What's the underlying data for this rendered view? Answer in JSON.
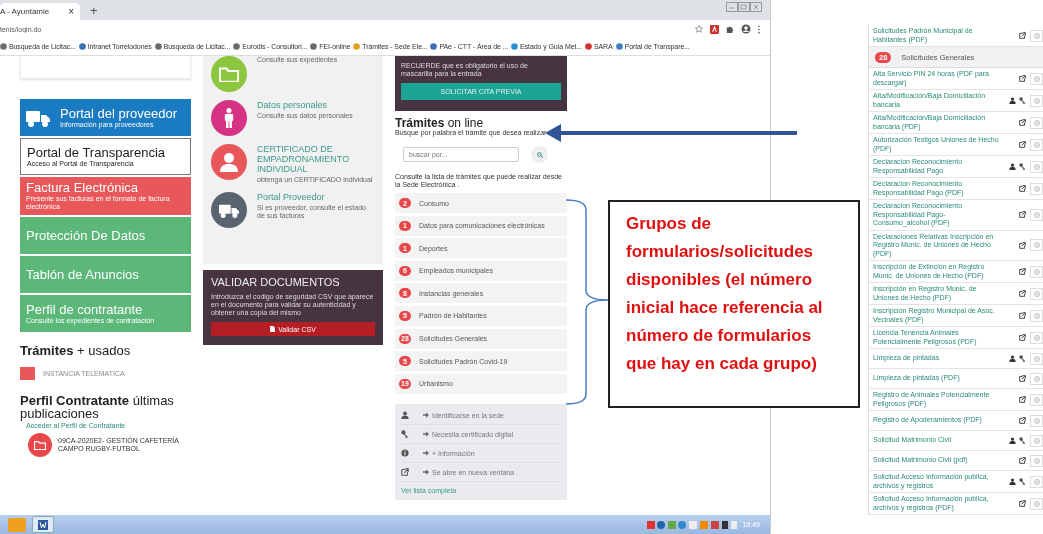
{
  "browser": {
    "tab": {
      "title": "A - Ayuntamie",
      "close": "×"
    },
    "new_tab": "+",
    "address": "tenis/login.do",
    "bookmarks": [
      {
        "label": "Busqueda de Licitac...",
        "color": "#6b6b6b"
      },
      {
        "label": "Intranet Torrelodones",
        "color": "#3b6fb6"
      },
      {
        "label": "Busqueda de Licitac...",
        "color": "#6b6b6b"
      },
      {
        "label": "Eurodis - Consultori...",
        "color": "#6b6b6b"
      },
      {
        "label": "FEI-online",
        "color": "#6b6b6b"
      },
      {
        "label": "Trámites - Sede Ele...",
        "color": "#e0a020"
      },
      {
        "label": "PAe - CTT - Área de ...",
        "color": "#3b6fb6"
      },
      {
        "label": "Estado y Guía Met...",
        "color": "#2a8fd0"
      },
      {
        "label": "SARA",
        "color": "#d83030"
      },
      {
        "label": "Portal de Transpare...",
        "color": "#3b7fc0"
      }
    ]
  },
  "page": {
    "tiles": [
      {
        "title": "**Portal** del proveedor",
        "subtitle": "Información para proveedores",
        "color": "#1a7ac2"
      },
      {
        "title": "Portal de Transparencia",
        "subtitle": "Acceso al Portal de Transparencia",
        "color": "#ffffff"
      },
      {
        "title": "**Factura** Electrónica",
        "subtitle": "Presente sus facturas en el formato de factura electrónica",
        "color": "#e8585a"
      },
      {
        "title": "Protección De Datos",
        "color": "#5cb878"
      },
      {
        "title": "Tablón de Anuncios",
        "color": "#5cb878"
      },
      {
        "title": "**Perfil** de contratante",
        "subtitle": "Consulte los expedientes de contratación",
        "color": "#5cb878"
      }
    ],
    "most_used": {
      "title": "**Trámites** + usados",
      "items": [
        {
          "label": "INSTANCIA TELEMATICA"
        }
      ]
    },
    "contractor": {
      "title": "**Perfil Contratante** últimas publicaciones",
      "link": "Acceder al Perfil de Contratante",
      "items": [
        {
          "label": "09CA-2020E2- GESTIÓN CAFETERÍA CAMPO RUGBY-FUTBOL"
        }
      ]
    },
    "services": [
      {
        "color": "#8cc63f",
        "description": "Consulte sus expedientes"
      },
      {
        "color": "#d63384",
        "title": "Datos personales",
        "description": "Consulte sus datos personales"
      },
      {
        "color": "#e8585a",
        "title": "CERTIFICADO DE EMPADRONAMIENTO INDIVIDUAL",
        "description": "obtenga un CERTIFICADO individual"
      },
      {
        "color": "#5a6470",
        "title": "Portal Proveedor",
        "description": "Si es proveedor, consulte el estado de sus facturas"
      }
    ],
    "validate": {
      "title": "VALIDAR DOCUMENTOS",
      "text": "Introduzca el codigo de seguridad CSV que aparece en el documento para validar su autenticidad y obtener una copia del mismo",
      "button": "Validar CSV"
    },
    "notice": {
      "text": "RECUERDE que es obligatorio el uso de mascarilla para la entrada",
      "button": "SOLICITAR CITA PREVIA"
    },
    "online": {
      "title": "**Trámites** on line",
      "subtitle": "Busque por palabra el trámite que desea realizar",
      "search": {
        "placeholder": "buscar por..."
      },
      "intro": "Consulte la lista de trámites que puede realizar desde la Sede Electrónica .",
      "groups": [
        {
          "count": "2",
          "label": "Consumo"
        },
        {
          "count": "1",
          "label": "Datos para comunicaciones electrónicas"
        },
        {
          "count": "1",
          "label": "Deportes"
        },
        {
          "count": "6",
          "label": "Empleados municipales"
        },
        {
          "count": "8",
          "label": "Instancias generales"
        },
        {
          "count": "5",
          "label": "Padrón de Habitantes"
        },
        {
          "count": "28",
          "label": "Solicitudes Generales"
        },
        {
          "count": "5",
          "label": "Solicitudes Padrón Covid-19"
        },
        {
          "count": "19",
          "label": "Urbanismo"
        }
      ],
      "legend": [
        {
          "kind": "user",
          "label": "Identificarse en la sede"
        },
        {
          "kind": "key",
          "label": "Necesita certificado digital"
        },
        {
          "kind": "info",
          "label": "+ Información"
        },
        {
          "kind": "external",
          "label": "Se abre en nueva ventana"
        }
      ],
      "more": "Ver lista completa"
    }
  },
  "taskbar": {
    "time": "18:49"
  },
  "annotation": {
    "note": "Grupos de formularios/solicitudes disponibles (el número inicial hace referencia al número de formularios que hay en cada grupo)"
  },
  "forms": [
    {
      "kind": "pdf",
      "label": "Solicitudes Padrón Municipal de Habitantes (PDF)"
    },
    {
      "kind": "group",
      "count": "28",
      "label": "Solicitudes Generales"
    },
    {
      "kind": "pdf",
      "label": "Alta Servicio PIN 24 horas (PDF para descargar)"
    },
    {
      "kind": "cert",
      "label": "Alta/Modificación/Baja Domiciliación bancaria"
    },
    {
      "kind": "pdf",
      "label": "Alta/Modificación/Baja Domiciliación bancaria (PDF)"
    },
    {
      "kind": "pdf",
      "label": "Autorización Testigos Uniones de Hecho (PDF)"
    },
    {
      "kind": "cert",
      "label": "Declaracion Reconocimiento Responsabilidad Pago"
    },
    {
      "kind": "pdf",
      "label": "Declaracion Reconocimiento Responsabilidad Pago (PDF)"
    },
    {
      "kind": "pdf",
      "label": "Declaracion Reconocimiento Responsabilidad Pago- Consumo_alcohol (PDF)"
    },
    {
      "kind": "pdf",
      "label": "Declaraciones Relativas Inscripción en Registro Munic. de Uniones de Hecho (PDF)"
    },
    {
      "kind": "pdf",
      "label": "Inscripción de Extinción en Registro Munic. de Uniones de Hecho (PDF)"
    },
    {
      "kind": "pdf",
      "label": "Inscripción en Registro Munic. de Uniones de Hecho (PDF)"
    },
    {
      "kind": "pdf",
      "label": "Inscripción Registro Municipal de Asoc. Vecinales (PDF)"
    },
    {
      "kind": "pdf",
      "label": "Licencia Tenencia Animales Potencialmente Peligrosos (PDF)"
    },
    {
      "kind": "cert",
      "label": "Limpieza de pintadas"
    },
    {
      "kind": "pdf",
      "label": "Limpieza de pintadas (PDF)"
    },
    {
      "kind": "pdf",
      "label": "Registro de Animales Potencialmente Peligrosos (PDF)"
    },
    {
      "kind": "pdf",
      "label": "Registro de Apoderamientos (PDF)"
    },
    {
      "kind": "cert",
      "label": "Solicitud Matrimonio Civil"
    },
    {
      "kind": "pdf",
      "label": "Solicitud Matrimonio Civil (pdf)"
    },
    {
      "kind": "cert",
      "label": "Solicitud Acceso Información publica, archivos y registros"
    },
    {
      "kind": "pdf",
      "label": "Solicitud Acceso Información publica, archivos y registros (PDF)"
    }
  ]
}
